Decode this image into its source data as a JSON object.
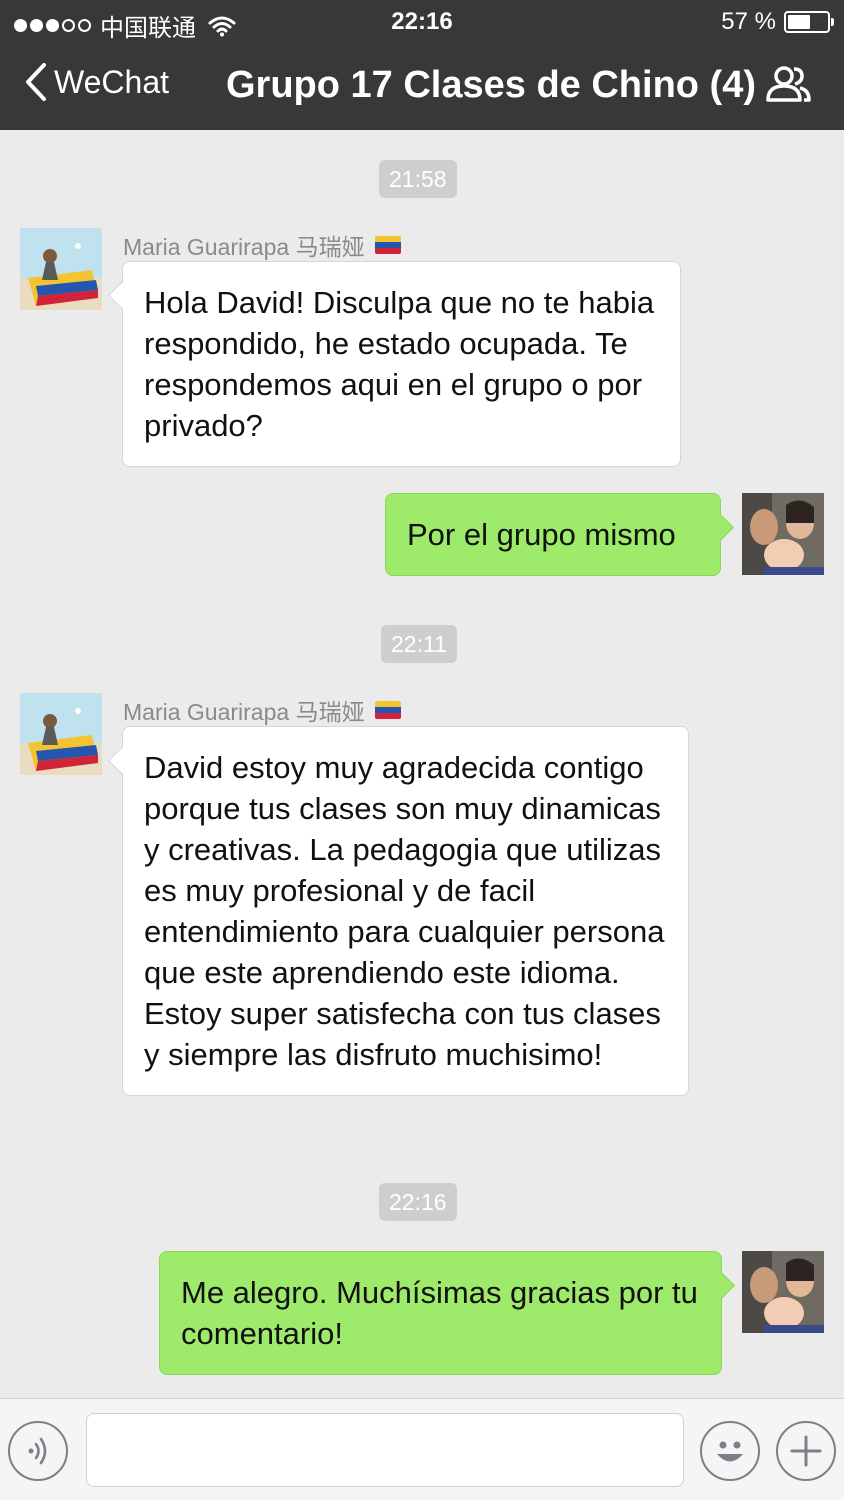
{
  "status_bar": {
    "carrier": "中国联通",
    "time": "22:16",
    "battery": "57 %",
    "battery_level": 0.57,
    "signal_bars": 3
  },
  "nav": {
    "back_label": "WeChat",
    "title": "Grupo 17 Clases de Chino (4)",
    "back_icon": "chevron-left-icon",
    "group_icon": "group-members-icon"
  },
  "chat": {
    "stamps": [
      "21:58",
      "22:11",
      "22:16"
    ],
    "messages": [
      {
        "sender": "Maria Guarirapa 马瑞娅",
        "text": "Hola David! Disculpa que no te habia respondido, he estado ocupada. Te respondemos aqui en el grupo o por privado?"
      },
      {
        "text": "Por el grupo mismo"
      },
      {
        "sender": "Maria Guarirapa 马瑞娅",
        "text": "David estoy muy agradecida contigo porque tus clases son muy dinamicas y creativas. La pedagogia que utilizas es muy profesional y de facil entendimiento para cualquier persona que este aprendiendo este idioma. Estoy super satisfecha con tus clases y siempre las disfruto muchisimo!"
      },
      {
        "text": "Me alegro. Muchísimas gracias por tu comentario!"
      }
    ]
  },
  "input_bar": {
    "voice_icon": "voice-input-icon",
    "emoji_icon": "emoji-icon",
    "plus_icon": "plus-icon",
    "text_value": ""
  },
  "colors": {
    "header_bg": "#383838",
    "chat_bg": "#ebebeb",
    "outgoing_bubble": "#9eea6a",
    "incoming_bubble": "#ffffff",
    "timestamp_bg": "#cecece"
  }
}
